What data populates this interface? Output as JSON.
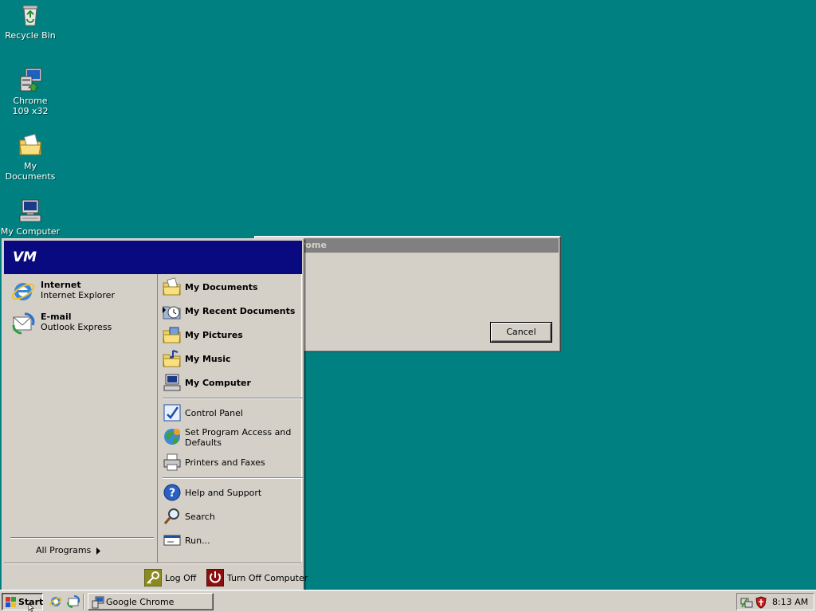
{
  "desktop": {
    "icons": [
      {
        "label": "Recycle Bin",
        "icon": "recycle-bin-icon"
      },
      {
        "label": "Chrome 109 x32",
        "icon": "chrome-installer-icon"
      },
      {
        "label": "My Documents",
        "icon": "my-documents-folder-icon"
      },
      {
        "label": "My Computer",
        "icon": "my-computer-icon"
      }
    ]
  },
  "dialog": {
    "title": "rome",
    "cancel_label": "Cancel"
  },
  "start_menu": {
    "user": "VM",
    "pinned": [
      {
        "title": "Internet",
        "subtitle": "Internet Explorer",
        "icon": "internet-explorer-icon"
      },
      {
        "title": "E-mail",
        "subtitle": "Outlook Express",
        "icon": "outlook-express-icon"
      }
    ],
    "all_programs": "All Programs",
    "right": [
      {
        "label": "My Documents",
        "icon": "my-documents-icon"
      },
      {
        "label": "My Recent Documents",
        "icon": "recent-documents-icon"
      },
      {
        "label": "My Pictures",
        "icon": "my-pictures-icon"
      },
      {
        "label": "My Music",
        "icon": "my-music-icon"
      },
      {
        "label": "My Computer",
        "icon": "my-computer-icon"
      },
      {
        "label": "Control Panel",
        "icon": "control-panel-icon"
      },
      {
        "label": "Set Program Access and Defaults",
        "icon": "program-access-icon"
      },
      {
        "label": "Printers and Faxes",
        "icon": "printer-icon"
      },
      {
        "label": "Help and Support",
        "icon": "help-icon"
      },
      {
        "label": "Search",
        "icon": "search-icon"
      },
      {
        "label": "Run...",
        "icon": "run-icon"
      }
    ],
    "log_off": "Log Off",
    "turn_off": "Turn Off Computer"
  },
  "taskbar": {
    "start_label": "Start",
    "task_label": "Google Chrome",
    "clock": "8:13 AM"
  },
  "colors": {
    "desktop": "#008080",
    "menu_header": "#0a0a80",
    "face": "#d4d0c8"
  }
}
